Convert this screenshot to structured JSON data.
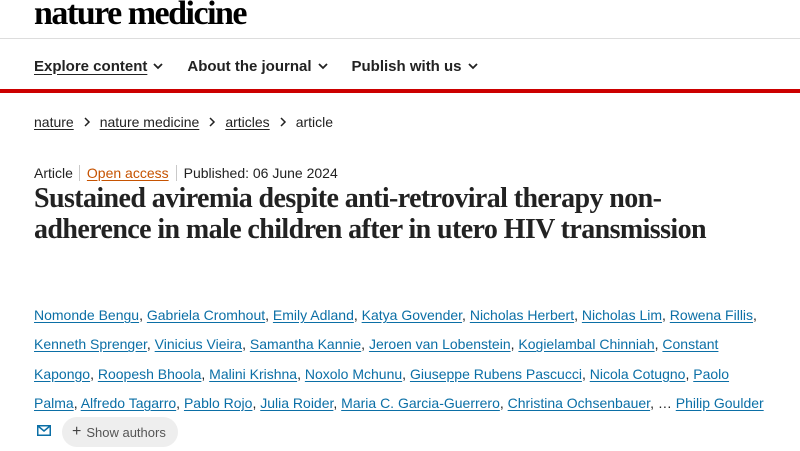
{
  "brand": {
    "logo_text": "nature medicine"
  },
  "nav": {
    "items": [
      {
        "label": "Explore content"
      },
      {
        "label": "About the journal"
      },
      {
        "label": "Publish with us"
      }
    ]
  },
  "breadcrumb": [
    "nature",
    "nature medicine",
    "articles",
    "article"
  ],
  "article": {
    "type": "Article",
    "access": "Open access",
    "published": "Published: 06 June 2024",
    "title": "Sustained aviremia despite anti-retroviral therapy non-adherence in male children after in utero HIV transmission",
    "authors": [
      "Nomonde Bengu",
      "Gabriela Cromhout",
      "Emily Adland",
      "Katya Govender",
      "Nicholas Herbert",
      "Nicholas Lim",
      "Rowena Fillis",
      "Kenneth Sprenger",
      "Vinicius Vieira",
      "Samantha Kannie",
      "Jeroen van Lobenstein",
      "Kogielambal Chinniah",
      "Constant Kapongo",
      "Roopesh Bhoola",
      "Malini Krishna",
      "Noxolo Mchunu",
      "Giuseppe Rubens Pascucci",
      "Nicola Cotugno",
      "Paolo Palma",
      "Alfredo Tagarro",
      "Pablo Rojo",
      "Julia Roider",
      "Maria C. Garcia-Guerrero",
      "Christina Ochsenbauer"
    ],
    "ellipsis": "…",
    "last_author": "Philip Goulder",
    "show_authors": "Show authors"
  },
  "colors": {
    "accent_red": "#cc0000",
    "link_blue": "#0b6fa6",
    "open_access": "#c65301"
  },
  "icons": {
    "nav_dropdown": "chevron-down-icon",
    "breadcrumb_sep": "chevron-right-icon",
    "contact": "mail-icon",
    "expand": "plus-icon"
  }
}
